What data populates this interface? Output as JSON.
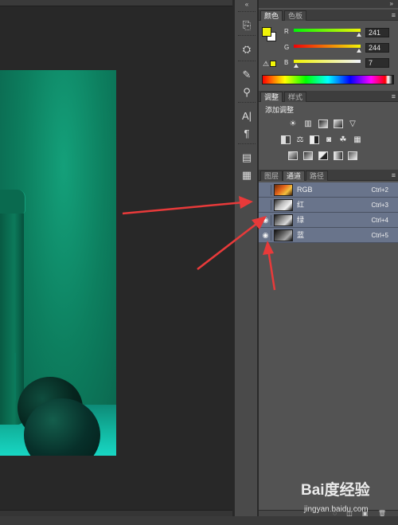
{
  "color_panel": {
    "tabs": [
      "颜色",
      "色板"
    ],
    "active_tab": 0,
    "channels": [
      {
        "label": "R",
        "value": "241"
      },
      {
        "label": "G",
        "value": "244"
      },
      {
        "label": "B",
        "value": "7"
      }
    ],
    "foreground_color": "#f1f407",
    "background_color": "#ffffff"
  },
  "adjustments_panel": {
    "tabs": [
      "调整",
      "样式"
    ],
    "active_tab": 0,
    "title": "添加调整"
  },
  "channels_panel": {
    "tabs": [
      "图层",
      "通道",
      "路径"
    ],
    "active_tab": 1,
    "rows": [
      {
        "name": "RGB",
        "shortcut": "Ctrl+2",
        "visible": false
      },
      {
        "name": "红",
        "shortcut": "Ctrl+3",
        "visible": false
      },
      {
        "name": "绿",
        "shortcut": "Ctrl+4",
        "visible": true
      },
      {
        "name": "蓝",
        "shortcut": "Ctrl+5",
        "visible": true
      }
    ]
  },
  "watermark": {
    "logo": "Bai度经验",
    "url": "jingyan.baidu.com"
  },
  "icons": {
    "collapse": "double-chevron-icon",
    "panel_menu": "panel-menu-icon",
    "visibility": "eye-icon"
  },
  "accent_colors": {
    "annotation_arrow": "#e83a3a",
    "selected_row": "#69748b"
  }
}
